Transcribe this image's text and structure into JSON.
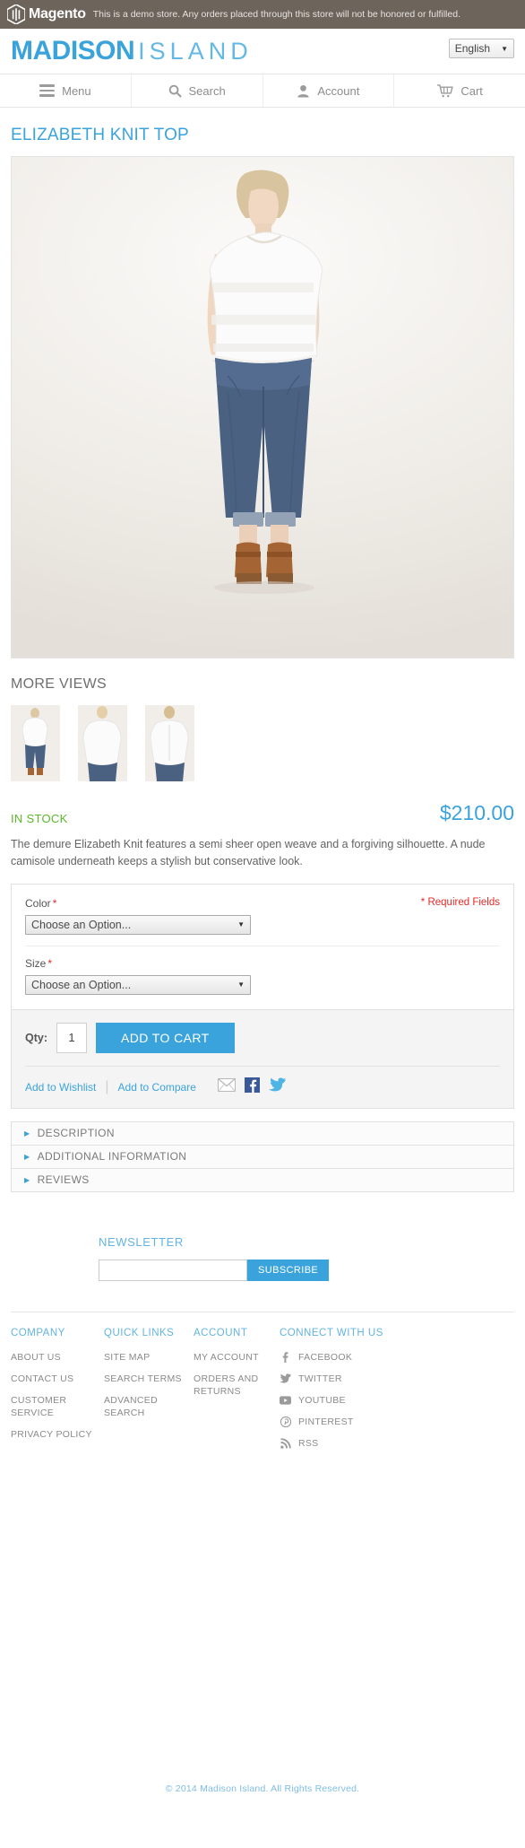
{
  "demo_banner": {
    "brand": "Magento",
    "notice": "This is a demo store. Any orders placed through this store will not be honored or fulfilled.",
    "bg_color": "#6d645b"
  },
  "header": {
    "logo_primary": "MADISON",
    "logo_secondary": "ISLAND",
    "brand_color": "#3aa3dc",
    "language": {
      "selected": "English",
      "caret": "▼"
    }
  },
  "nav": {
    "items": [
      {
        "label": "Menu",
        "icon": "hamburger-icon"
      },
      {
        "label": "Search",
        "icon": "search-icon"
      },
      {
        "label": "Account",
        "icon": "user-icon"
      },
      {
        "label": "Cart",
        "icon": "cart-icon"
      }
    ]
  },
  "product": {
    "title": "ELIZABETH KNIT TOP",
    "more_views_label": "MORE VIEWS",
    "thumbnail_count": 3,
    "availability": "IN STOCK",
    "availability_color": "#5bb72b",
    "price": "$210.00",
    "price_color": "#3aa3dc",
    "short_description": "The demure Elizabeth Knit features a semi sheer open weave and a forgiving silhouette. A nude camisole underneath keeps a stylish but conservative look.",
    "required_note": "* Required Fields",
    "options": [
      {
        "label": "Color",
        "required": "*",
        "selected": "Choose an Option...",
        "caret": "▼"
      },
      {
        "label": "Size",
        "required": "*",
        "selected": "Choose an Option...",
        "caret": "▼"
      }
    ],
    "qty_label": "Qty:",
    "qty_value": "1",
    "add_to_cart_label": "ADD TO CART",
    "wishlist_label": "Add to Wishlist",
    "compare_label": "Add to Compare",
    "share": [
      {
        "name": "email-icon"
      },
      {
        "name": "facebook-icon"
      },
      {
        "name": "twitter-icon"
      }
    ],
    "tabs": [
      {
        "label": "DESCRIPTION"
      },
      {
        "label": "ADDITIONAL INFORMATION"
      },
      {
        "label": "REVIEWS"
      }
    ]
  },
  "newsletter": {
    "title": "NEWSLETTER",
    "input_value": "",
    "input_placeholder": "",
    "button_label": "SUBSCRIBE"
  },
  "footer": {
    "columns": [
      {
        "heading": "COMPANY",
        "links": [
          "ABOUT US",
          "CONTACT US",
          "CUSTOMER SERVICE",
          "PRIVACY POLICY"
        ]
      },
      {
        "heading": "QUICK LINKS",
        "links": [
          "SITE MAP",
          "SEARCH TERMS",
          "ADVANCED SEARCH"
        ]
      },
      {
        "heading": "ACCOUNT",
        "links": [
          "MY ACCOUNT",
          "ORDERS AND RETURNS"
        ]
      }
    ],
    "connect": {
      "heading": "CONNECT WITH US",
      "links": [
        {
          "label": "FACEBOOK",
          "icon": "facebook-icon"
        },
        {
          "label": "TWITTER",
          "icon": "twitter-icon"
        },
        {
          "label": "YOUTUBE",
          "icon": "youtube-icon"
        },
        {
          "label": "PINTEREST",
          "icon": "pinterest-icon"
        },
        {
          "label": "RSS",
          "icon": "rss-icon"
        }
      ]
    },
    "copyright": "© 2014 Madison Island. All Rights Reserved."
  }
}
